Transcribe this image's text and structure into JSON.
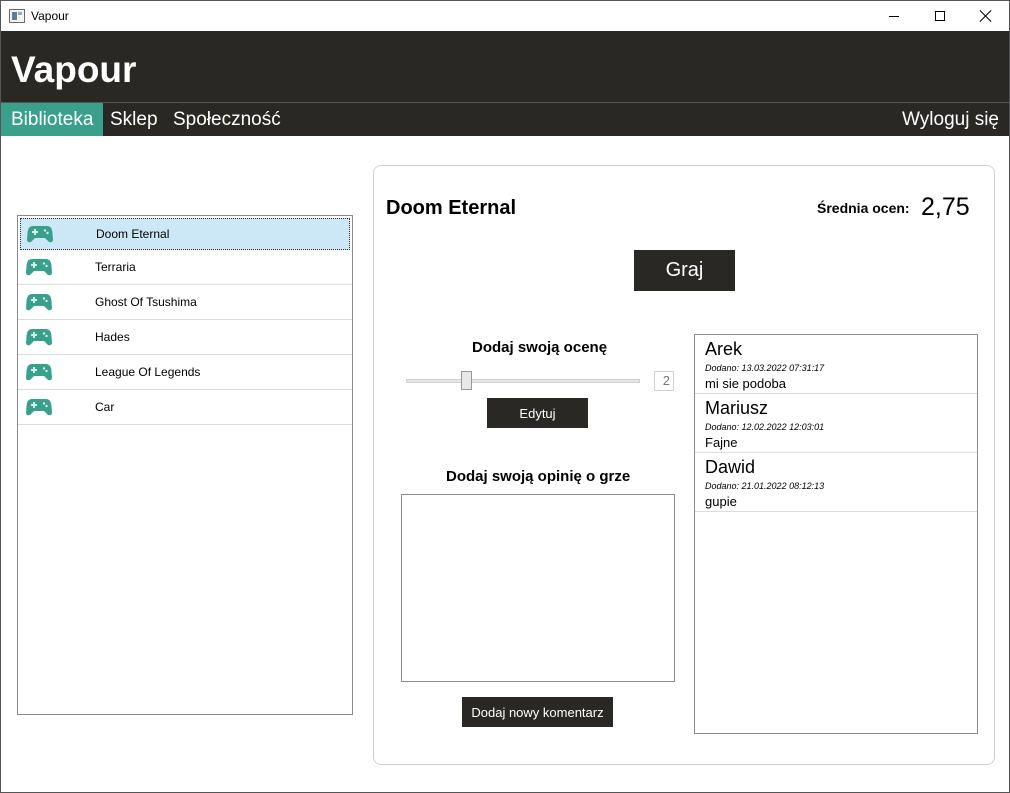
{
  "window": {
    "title": "Vapour"
  },
  "header": {
    "logo": "Vapour"
  },
  "nav": {
    "items": [
      {
        "label": "Biblioteka",
        "active": true
      },
      {
        "label": "Sklep",
        "active": false
      },
      {
        "label": "Społeczność",
        "active": false
      }
    ],
    "logout": "Wyloguj się"
  },
  "colors": {
    "header_bg": "#292825",
    "accent": "#3aa08c",
    "selection": "#cce8f6"
  },
  "library": {
    "icon": "gamepad-icon",
    "games": [
      {
        "name": "Doom Eternal",
        "selected": true
      },
      {
        "name": "Terraria",
        "selected": false
      },
      {
        "name": "Ghost Of Tsushima",
        "selected": false
      },
      {
        "name": "Hades",
        "selected": false
      },
      {
        "name": "League Of Legends",
        "selected": false
      },
      {
        "name": "Car",
        "selected": false
      }
    ]
  },
  "details": {
    "title": "Doom Eternal",
    "avg_label": "Średnia ocen:",
    "avg_value": "2,75",
    "play_label": "Graj",
    "rate_label": "Dodaj swoją ocenę",
    "rating_value": "2",
    "rating_fraction": 0.25,
    "edit_label": "Edytuj",
    "opinion_label": "Dodaj swoją opinię o grze",
    "opinion_text": "",
    "add_comment_label": "Dodaj nowy komentarz"
  },
  "comments": [
    {
      "author": "Arek",
      "date": "Dodano:   13.03.2022 07:31:17",
      "text": "mi sie podoba"
    },
    {
      "author": "Mariusz",
      "date": "Dodano:   12.02.2022 12:03:01",
      "text": "Fajne"
    },
    {
      "author": "Dawid",
      "date": "Dodano:   21.01.2022 08:12:13",
      "text": "gupie"
    }
  ]
}
